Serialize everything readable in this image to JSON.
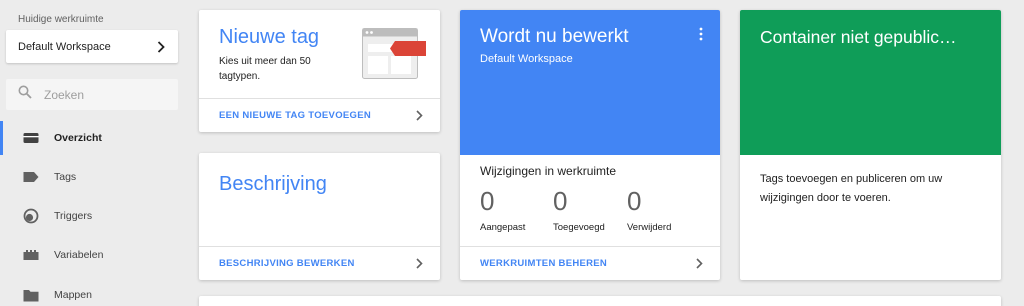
{
  "sidebar": {
    "workspace_label": "Huidige werkruimte",
    "workspace_name": "Default Workspace",
    "search_placeholder": "Zoeken",
    "items": [
      {
        "label": "Overzicht",
        "icon": "briefcase-icon",
        "active": true
      },
      {
        "label": "Tags",
        "icon": "tag-icon",
        "active": false
      },
      {
        "label": "Triggers",
        "icon": "trigger-icon",
        "active": false
      },
      {
        "label": "Variabelen",
        "icon": "blocks-icon",
        "active": false
      },
      {
        "label": "Mappen",
        "icon": "folder-icon",
        "active": false
      }
    ]
  },
  "cards": {
    "new_tag": {
      "title": "Nieuwe tag",
      "description": "Kies uit meer dan 50 tagtypen.",
      "action": "EEN NIEUWE TAG TOEVOEGEN"
    },
    "description": {
      "title": "Beschrijving",
      "action": "BESCHRIJVING BEWERKEN"
    },
    "editing": {
      "title": "Wordt nu bewerkt",
      "subtitle": "Default Workspace",
      "changes_label": "Wijzigingen in werkruimte",
      "stats": [
        {
          "value": "0",
          "label": "Aangepast"
        },
        {
          "value": "0",
          "label": "Toegevoegd"
        },
        {
          "value": "0",
          "label": "Verwijderd"
        }
      ],
      "action": "WERKRUIMTEN BEHEREN"
    },
    "publish": {
      "title": "Container niet gepublic…",
      "body": "Tags toevoegen en publiceren om uw wijzigingen door te voeren."
    }
  },
  "colors": {
    "accent_blue": "#4285f4",
    "publish_green": "#0f9d58",
    "tag_red": "#db4437"
  }
}
